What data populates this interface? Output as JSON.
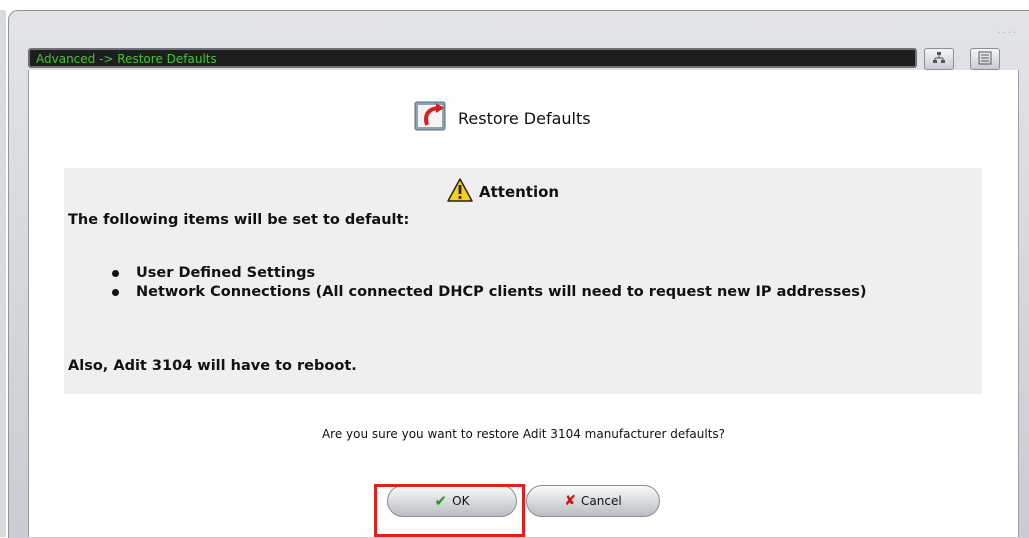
{
  "window": {
    "breadcrumb": "Advanced -> Restore Defaults",
    "grip": "....",
    "buttons": {
      "network_icon": "network-map-icon",
      "list_icon": "list-view-icon"
    }
  },
  "page": {
    "title": "Restore Defaults",
    "title_icon": "restore-icon"
  },
  "attention": {
    "icon": "warning-icon",
    "title": "Attention",
    "intro": "The following items will be set to default:",
    "items": [
      "User Defined Settings",
      "Network Connections (All connected DHCP clients will need to request new IP addresses)"
    ],
    "note": "Also, Adit 3104 will have to reboot."
  },
  "confirm": {
    "question": "Are you sure you want to restore Adit 3104 manufacturer defaults?",
    "ok_label": "OK",
    "cancel_label": "Cancel"
  },
  "colors": {
    "breadcrumb_text": "#46c236",
    "highlight_border": "#e0201c",
    "ok_check": "#1f9a1f",
    "cancel_x": "#cc1111"
  }
}
